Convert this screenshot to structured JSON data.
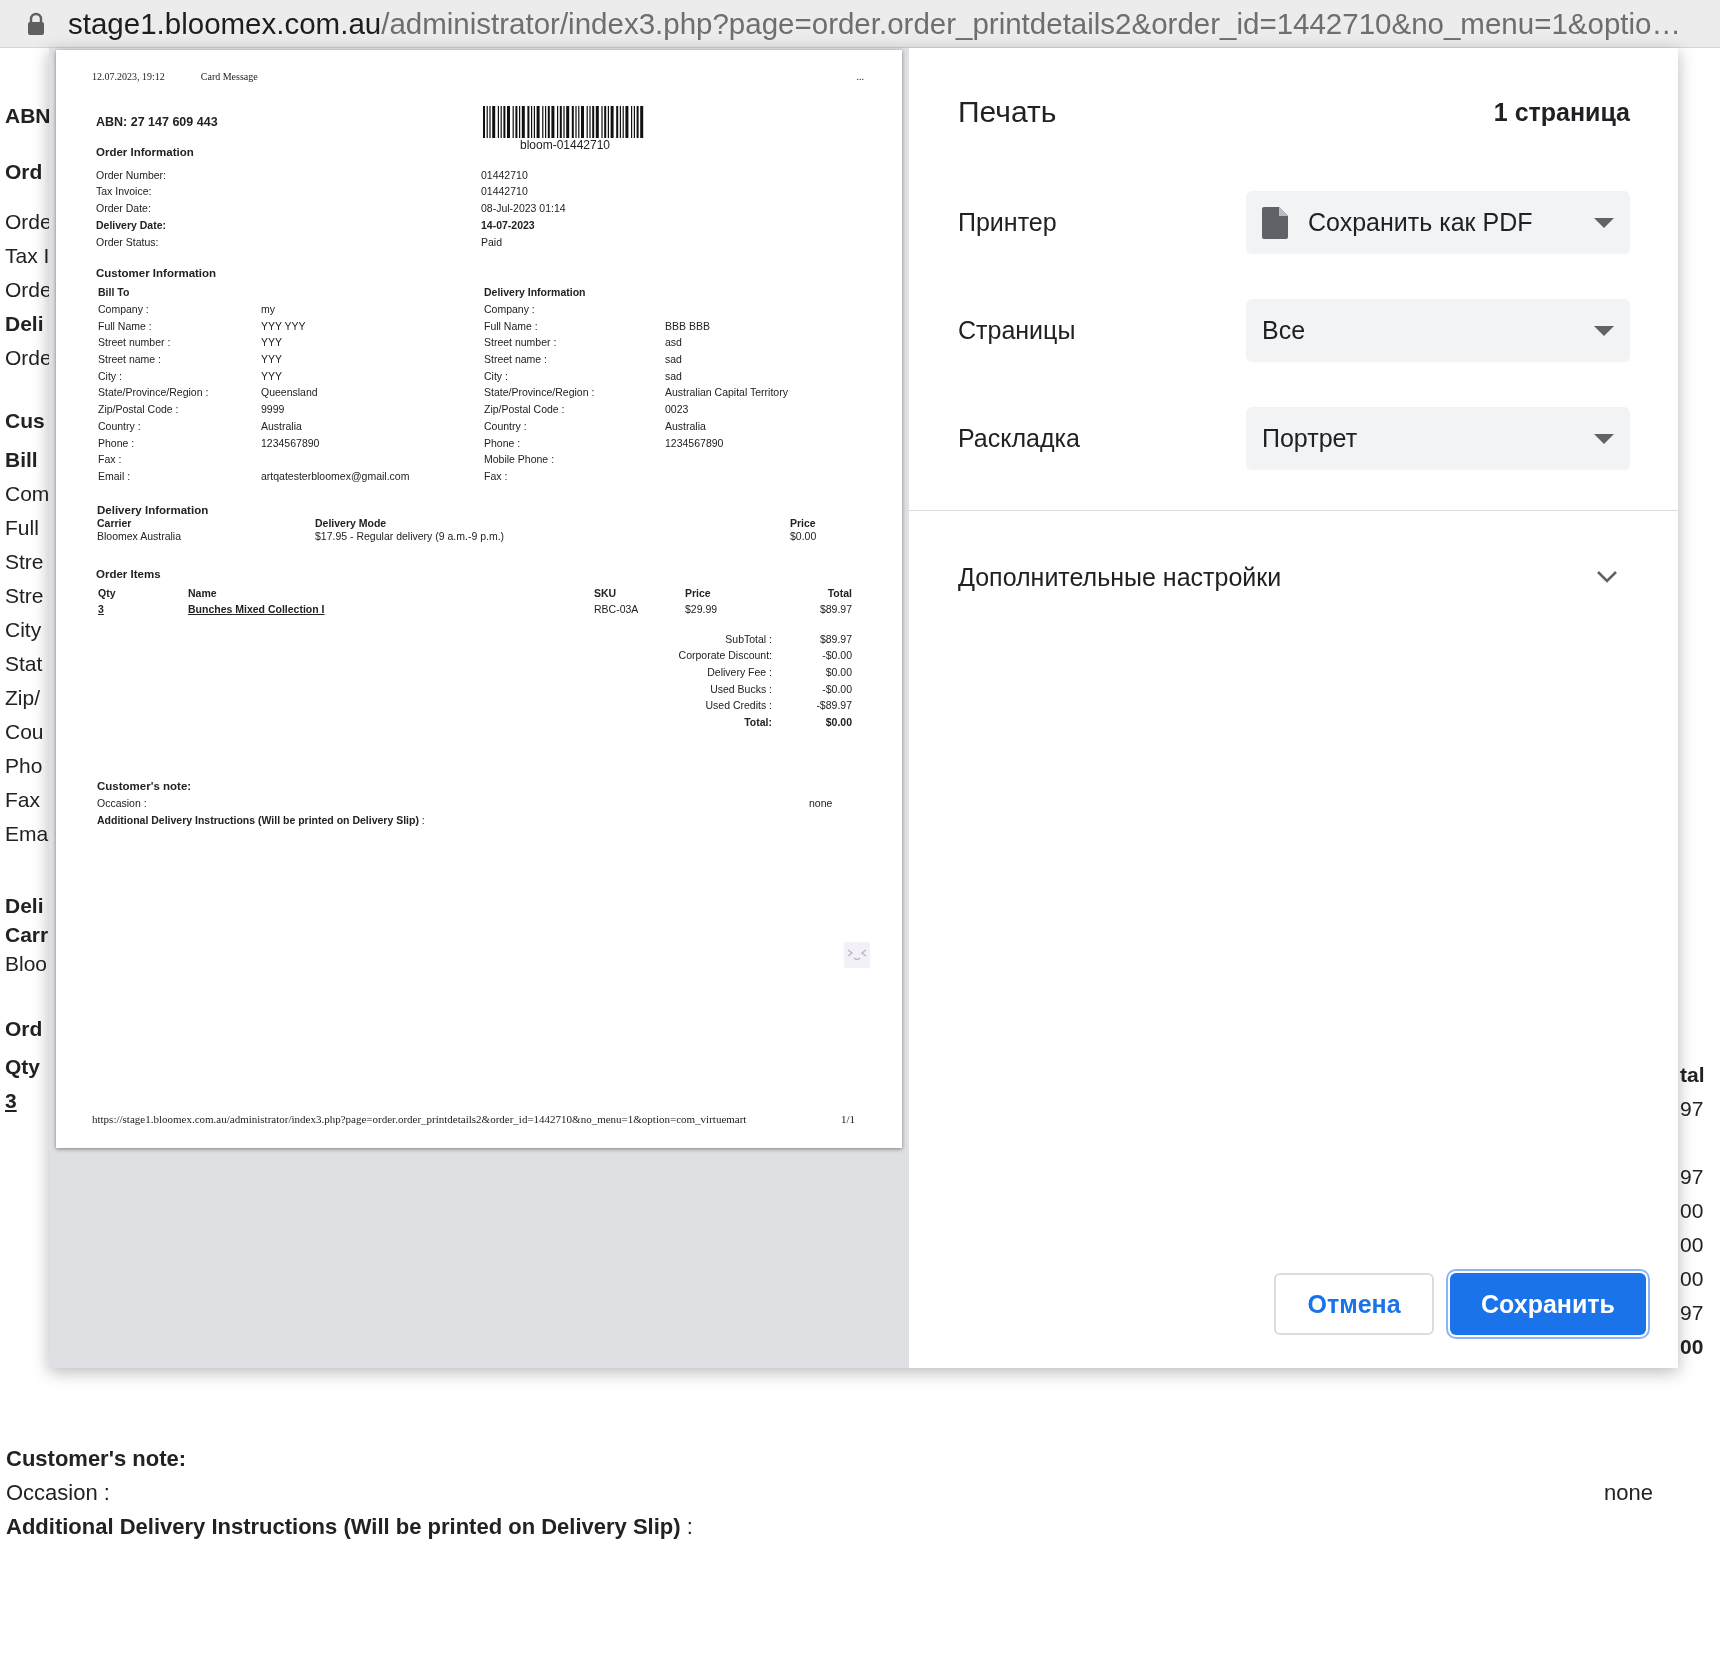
{
  "address_bar": {
    "host": "stage1.bloomex.com.au",
    "path": "/administrator/index3.php?page=order.order_printdetails2&order_id=1442710&no_menu=1&optio…"
  },
  "background_page": {
    "left_edge": [
      [
        {
          "text": "ABN",
          "kind": "heading"
        }
      ],
      [
        {
          "text": "Ord",
          "kind": "heading"
        }
      ],
      [
        {
          "text": "Orde",
          "kind": "text"
        },
        {
          "text": "Tax I",
          "kind": "text"
        },
        {
          "text": "Orde",
          "kind": "text"
        },
        {
          "text": "Deli",
          "kind": "heading"
        },
        {
          "text": "Orde",
          "kind": "text"
        }
      ],
      [
        {
          "text": "Cus",
          "kind": "heading"
        }
      ],
      [
        {
          "text": "Bill",
          "kind": "heading"
        },
        {
          "text": "Com",
          "kind": "text"
        },
        {
          "text": "Full",
          "kind": "text"
        },
        {
          "text": "Stre",
          "kind": "text"
        },
        {
          "text": "Stre",
          "kind": "text"
        },
        {
          "text": "City",
          "kind": "text"
        },
        {
          "text": "Stat",
          "kind": "text"
        },
        {
          "text": "Zip/",
          "kind": "text"
        },
        {
          "text": "Cou",
          "kind": "text"
        },
        {
          "text": "Pho",
          "kind": "text"
        },
        {
          "text": "Fax",
          "kind": "text"
        },
        {
          "text": "Ema",
          "kind": "text"
        }
      ],
      [
        {
          "text": "Deli",
          "kind": "heading"
        },
        {
          "text": "Carr",
          "kind": "heading"
        },
        {
          "text": "Bloo",
          "kind": "text"
        }
      ],
      [
        {
          "text": "Ord",
          "kind": "heading"
        }
      ],
      [
        {
          "text": "Qty",
          "kind": "heading"
        },
        {
          "text": "3",
          "kind": "link"
        }
      ]
    ],
    "right_edge": [
      [
        {
          "text": "tal",
          "kind": "heading"
        },
        {
          "text": "97",
          "kind": "text"
        }
      ],
      [
        {
          "text": "97",
          "kind": "text"
        },
        {
          "text": "00",
          "kind": "text"
        },
        {
          "text": "00",
          "kind": "text"
        },
        {
          "text": "00",
          "kind": "text"
        },
        {
          "text": "97",
          "kind": "text"
        },
        {
          "text": "00",
          "kind": "heading"
        }
      ]
    ],
    "customer_note": {
      "title": "Customer's note:",
      "occasion_label": "Occasion :",
      "occasion_value": "none",
      "instructions": "**Additional Delivery Instructions (Will be printed on Delivery Slip)** :"
    }
  },
  "print_dialog": {
    "preview": {
      "header": {
        "date": "12.07.2023, 19:12",
        "title": "Card Message",
        "marker": "..."
      },
      "abn": "ABN: 27 147 609 443",
      "barcode_text": "bloom-01442710",
      "order_information": {
        "title": "Order Information",
        "rows": [
          {
            "label": "Order Number:",
            "value": "01442710",
            "bold": false
          },
          {
            "label": "Tax Invoice:",
            "value": "01442710",
            "bold": false
          },
          {
            "label": "Order Date:",
            "value": "08-Jul-2023 01:14",
            "bold": false
          },
          {
            "label": "Delivery Date:",
            "value": "14-07-2023",
            "bold": true
          },
          {
            "label": "Order Status:",
            "value": "Paid",
            "bold": false
          }
        ]
      },
      "customer_information": {
        "title": "Customer Information",
        "bill_to": {
          "title": "Bill To",
          "rows": [
            {
              "label": "Company :",
              "value": "my"
            },
            {
              "label": "Full Name :",
              "value": "YYY YYY"
            },
            {
              "label": "Street number :",
              "value": "YYY"
            },
            {
              "label": "Street name :",
              "value": "YYY"
            },
            {
              "label": "City :",
              "value": "YYY"
            },
            {
              "label": "State/Province/Region :",
              "value": "Queensland"
            },
            {
              "label": "Zip/Postal Code :",
              "value": "9999"
            },
            {
              "label": "Country :",
              "value": "Australia"
            },
            {
              "label": "Phone :",
              "value": "1234567890"
            },
            {
              "label": "Fax :"
            },
            {
              "label": "Email :",
              "value": "artqatesterbloomex@gmail.com"
            }
          ]
        },
        "delivery": {
          "title": "Delivery Information",
          "rows": [
            {
              "label": "Company :"
            },
            {
              "label": "Full Name :",
              "value": "BBB BBB"
            },
            {
              "label": "Street number :",
              "value": "asd"
            },
            {
              "label": "Street name :",
              "value": "sad"
            },
            {
              "label": "City :",
              "value": "sad"
            },
            {
              "label": "State/Province/Region :",
              "value": "Australian Capital Territory"
            },
            {
              "label": "Zip/Postal Code :",
              "value": "0023"
            },
            {
              "label": "Country :",
              "value": "Australia"
            },
            {
              "label": "Phone :",
              "value": "1234567890"
            },
            {
              "label": "Mobile Phone :"
            },
            {
              "label": "Fax :"
            }
          ]
        }
      },
      "delivery_information": {
        "title": "Delivery Information",
        "columns": [
          {
            "heading": "Carrier",
            "value": "Bloomex Australia"
          },
          {
            "heading": "Delivery Mode",
            "value": "$17.95 - Regular delivery (9 a.m.-9 p.m.)"
          },
          {
            "heading": "Price",
            "value": "$0.00"
          }
        ]
      },
      "order_items": {
        "title": "Order Items",
        "columns": [
          "Qty",
          "Name",
          "SKU",
          "Price",
          "Total"
        ],
        "rows": [
          {
            "qty": "3",
            "name": "Bunches Mixed Collection I",
            "sku": "RBC-03A",
            "price": "$29.99",
            "total": "$89.97"
          }
        ]
      },
      "totals": [
        {
          "label": "SubTotal :",
          "value": "$89.97",
          "bold": false
        },
        {
          "label": "Corporate Discount:",
          "value": "-$0.00",
          "bold": false
        },
        {
          "label": "Delivery Fee :",
          "value": "$0.00",
          "bold": false
        },
        {
          "label": "Used Bucks :",
          "value": "-$0.00",
          "bold": false
        },
        {
          "label": "Used Credits :",
          "value": "-$89.97",
          "bold": false
        },
        {
          "label": "Total:",
          "value": "$0.00",
          "bold": true
        }
      ],
      "customer_note": {
        "title": "Customer's note:",
        "occasion_label": "Occasion :",
        "occasion_value": "none",
        "instructions": "**Additional Delivery Instructions (Will be printed on Delivery Slip)** :"
      },
      "footer": {
        "url": "https://stage1.bloomex.com.au/administrator/index3.php?page=order.order_printdetails2&order_id=1442710&no_menu=1&option=com_virtuemart",
        "page": "1/1"
      }
    },
    "title": "Печать",
    "page_count": "1 страница",
    "settings": [
      {
        "label": "Принтер",
        "value": "Сохранить как PDF",
        "kind": "destination"
      },
      {
        "label": "Страницы",
        "value": "Все",
        "kind": "select"
      },
      {
        "label": "Раскладка",
        "value": "Портрет",
        "kind": "select"
      }
    ],
    "more_settings": {
      "label": "Дополнительные настройки",
      "expanded": false
    },
    "buttons": [
      {
        "label": "Отмена",
        "kind": "secondary"
      },
      {
        "label": "Сохранить",
        "kind": "primary"
      }
    ]
  }
}
